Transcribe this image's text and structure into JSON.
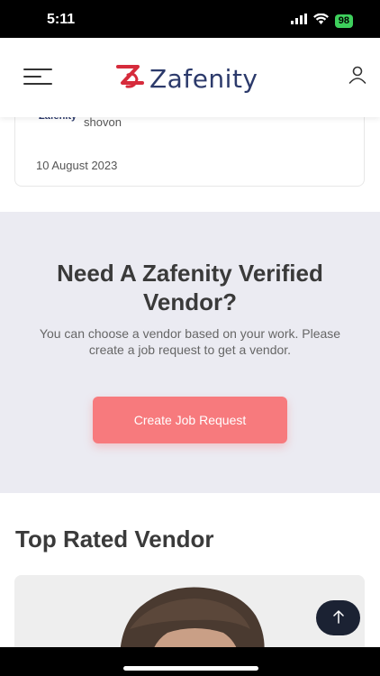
{
  "status": {
    "time": "5:11",
    "battery": "98"
  },
  "header": {
    "logo_text": "Zafenity"
  },
  "card": {
    "brand": "Zafenity",
    "author": "shovon",
    "date": "10 August 2023"
  },
  "cta": {
    "title": "Need A Zafenity Verified Vendor?",
    "subtitle": "You can choose a vendor based on your work. Please create a job request to get a vendor.",
    "button": "Create Job Request"
  },
  "section": {
    "title": "Top Rated Vendor"
  },
  "colors": {
    "brand": "#2c3a6b",
    "accent": "#f77a7d",
    "logo_mark": "#d62b3b"
  }
}
